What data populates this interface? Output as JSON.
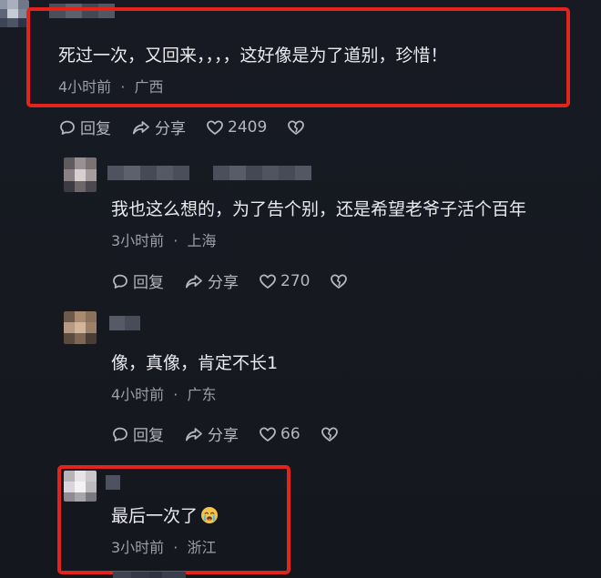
{
  "comments": [
    {
      "text": "死过一次，又回来，，，，这好像是为了道别，珍惜！",
      "time": "4小时前",
      "location": "广西",
      "reply_label": "回复",
      "share_label": "分享",
      "likes": "2409"
    },
    {
      "text": "我也这么想的，为了告个别，还是希望老爷子活个百年",
      "time": "3小时前",
      "location": "上海",
      "reply_label": "回复",
      "share_label": "分享",
      "likes": "270"
    },
    {
      "text": "像，真像，肯定不长1",
      "time": "4小时前",
      "location": "广东",
      "reply_label": "回复",
      "share_label": "分享",
      "likes": "66"
    },
    {
      "text": "最后一次了",
      "emoji": "crying-face",
      "time": "3小时前",
      "location": "浙江"
    }
  ],
  "meta_separator": "·",
  "colors": {
    "background": "#171a22",
    "highlight": "#e3241c",
    "meta_text": "#9c9ea8",
    "comment_text": "#eaeaee"
  },
  "icons": [
    "comment-bubble-icon",
    "share-arrow-icon",
    "heart-icon",
    "broken-heart-icon",
    "crying-face-emoji"
  ]
}
